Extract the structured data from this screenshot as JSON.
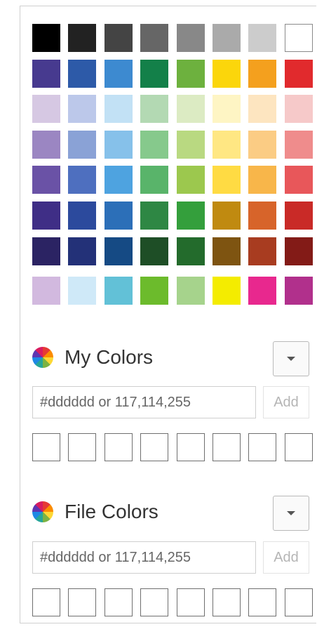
{
  "palette": {
    "rows": [
      [
        "#000000",
        "#222222",
        "#444444",
        "#666666",
        "#888888",
        "#aaaaaa",
        "#cccccc",
        "#ffffff"
      ],
      [
        "#473a8f",
        "#2d5aa8",
        "#3d8ad0",
        "#138049",
        "#6db13e",
        "#fbd60b",
        "#f4a01e",
        "#e12a2d"
      ],
      [
        "#d6c8e3",
        "#bcc8ea",
        "#c2e1f5",
        "#b3d9b3",
        "#dcebc3",
        "#fef5c4",
        "#fde5c0",
        "#f6c9c9"
      ],
      [
        "#9b86c2",
        "#8aa2d6",
        "#86c1ea",
        "#86c98c",
        "#b9d981",
        "#ffe783",
        "#fbcc84",
        "#ef8c8c"
      ],
      [
        "#6a52a6",
        "#4e6fbf",
        "#4ea3e0",
        "#59b46a",
        "#9cc84e",
        "#ffdb43",
        "#f8b64a",
        "#e8575a"
      ],
      [
        "#3f2e86",
        "#2c4a9d",
        "#2c6fb8",
        "#2e8744",
        "#349f3c",
        "#c08a10",
        "#d7642a",
        "#c92a27"
      ],
      [
        "#2b2363",
        "#233178",
        "#154a84",
        "#1e4e26",
        "#236b2c",
        "#7e5411",
        "#a83c20",
        "#831b17"
      ],
      [
        "#d2b9df",
        "#cfe9f8",
        "#62c1d7",
        "#6cbb2c",
        "#a6d38c",
        "#f4ec00",
        "#e8288e",
        "#b1308c"
      ]
    ]
  },
  "my_colors": {
    "title": "My Colors",
    "icon": "color-wheel-icon",
    "input_placeholder": "#dddddd or 117,114,255",
    "add_label": "Add",
    "slot_count": 8
  },
  "file_colors": {
    "title": "File Colors",
    "icon": "color-wheel-icon",
    "input_placeholder": "#dddddd or 117,114,255",
    "add_label": "Add",
    "slot_count": 8
  }
}
